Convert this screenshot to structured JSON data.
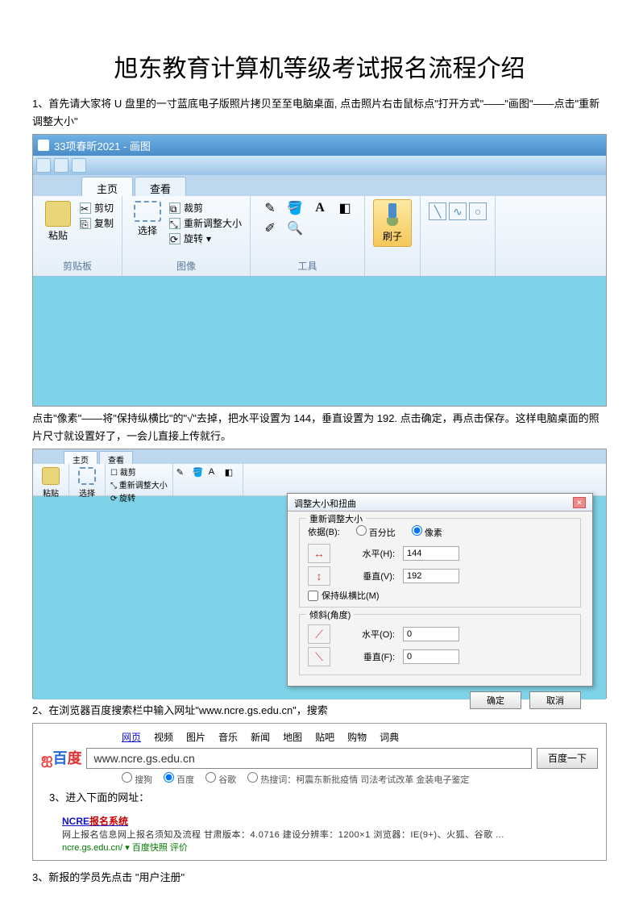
{
  "title": "旭东教育计算机等级考试报名流程介绍",
  "p1": "1、首先请大家将 U 盘里的一寸蓝底电子版照片拷贝至至电脑桌面, 点击照片右击鼠标点\"打开方式\"——\"画图\"——点击\"重新调整大小\"",
  "p2": "点击\"像素\"——将\"保持纵横比\"的\"√\"去掉，把水平设置为 144，垂直设置为 192. 点击确定，再点击保存。这样电脑桌面的照片尺寸就设置好了，一会儿直接上传就行。",
  "p3": "2、在浏览器百度搜索栏中输入网址\"www.ncre.gs.edu.cn\"，搜索",
  "p3b": "  3、进入下面的网址：",
  "p4": "3、新报的学员先点击 \"用户注册\"",
  "paint": {
    "window_title": "33项春昕2021 - 画图",
    "tab_home": "主页",
    "tab_view": "查看",
    "paste": "粘贴",
    "cut": "剪切",
    "copy": "复制",
    "clipboard": "剪贴板",
    "select": "选择",
    "crop": "裁剪",
    "resize": "重新调整大小",
    "rotate": "旋转",
    "image": "图像",
    "tools": "工具",
    "brush": "刷子"
  },
  "dlg": {
    "title": "调整大小和扭曲",
    "resize_sec": "重新调整大小",
    "by": "依据(B):",
    "percent": "百分比",
    "pixels": "像素",
    "h": "水平(H):",
    "v": "垂直(V):",
    "hv": "144",
    "vv": "192",
    "keep": "保持纵横比(M)",
    "skew_sec": "倾斜(角度)",
    "sh": "水平(O):",
    "sv": "垂直(F):",
    "zero": "0",
    "ok": "确定",
    "cancel": "取消"
  },
  "baidu": {
    "tabs": [
      "网页",
      "视频",
      "图片",
      "音乐",
      "新闻",
      "地图",
      "贴吧",
      "购物",
      "词典"
    ],
    "query": "www.ncre.gs.edu.cn",
    "btn": "百度一下",
    "opts_hot": "热搜词：柯震东新批疫情  司法考试改革  金装电子鉴定",
    "opt_sogou": "搜狗",
    "opt_baidu": "百度",
    "opt_google": "谷歌",
    "result_title_pre": "NCRE",
    "result_title_red": "报名系统",
    "result_snip": "网上报名信息网上报名须知及流程 甘肃版本：4.0716 建设分辨率：1200×1  浏览器：IE(9+)、火狐、谷歌 ...",
    "result_url": "ncre.gs.edu.cn/ ▾    百度快照    评价"
  }
}
